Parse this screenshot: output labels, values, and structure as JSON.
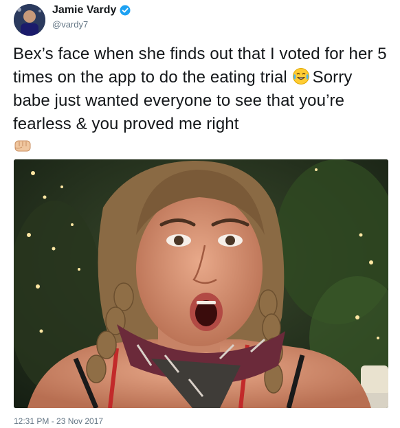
{
  "tweet": {
    "author": {
      "name": "Jamie Vardy",
      "handle": "@vardy7",
      "verified": true
    },
    "text_part1": "Bex’s face when she finds out that I voted for her 5 times on the app to do the eating trial",
    "text_part2": "Sorry babe just wanted everyone to see that you’re fearless & you proved me right",
    "emojis": [
      "face-with-tears-of-joy-icon",
      "oncoming-fist-icon"
    ],
    "timestamp": "12:31 PM - 23 Nov 2017"
  },
  "colors": {
    "text": "#14171a",
    "secondary": "#657786",
    "verified": "#1da1f2"
  }
}
